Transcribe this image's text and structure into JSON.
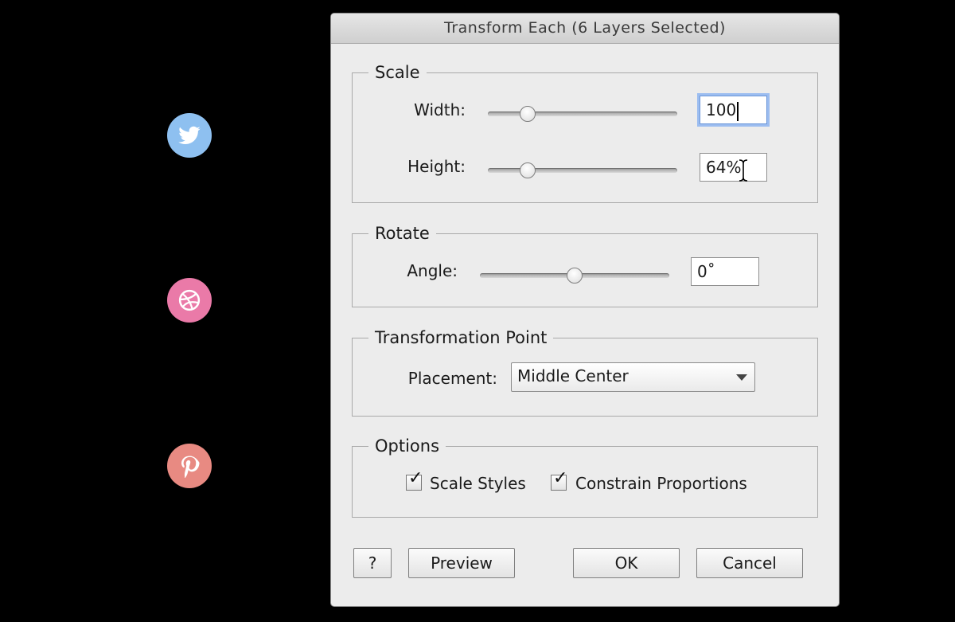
{
  "colors": {
    "twitter": "#8ec0f0",
    "dribbble": "#ea7aa8",
    "pinterest": "#e88a82"
  },
  "social_icons": [
    {
      "name": "twitter-icon"
    },
    {
      "name": "dribbble-icon"
    },
    {
      "name": "pinterest-icon"
    }
  ],
  "dialog": {
    "title": "Transform Each (6 Layers Selected)",
    "scale": {
      "legend": "Scale",
      "width_label": "Width:",
      "width_value": "100",
      "width_slider_fraction": 0.21,
      "height_label": "Height:",
      "height_value": "64%",
      "height_slider_fraction": 0.21
    },
    "rotate": {
      "legend": "Rotate",
      "angle_label": "Angle:",
      "angle_value": "0˚",
      "angle_slider_fraction": 0.5
    },
    "transformation_point": {
      "legend": "Transformation Point",
      "placement_label": "Placement:",
      "placement_value": "Middle Center"
    },
    "options": {
      "legend": "Options",
      "scale_styles_label": "Scale Styles",
      "scale_styles_checked": true,
      "constrain_label": "Constrain Proportions",
      "constrain_checked": true
    },
    "buttons": {
      "help": "?",
      "preview": "Preview",
      "ok": "OK",
      "cancel": "Cancel"
    }
  }
}
